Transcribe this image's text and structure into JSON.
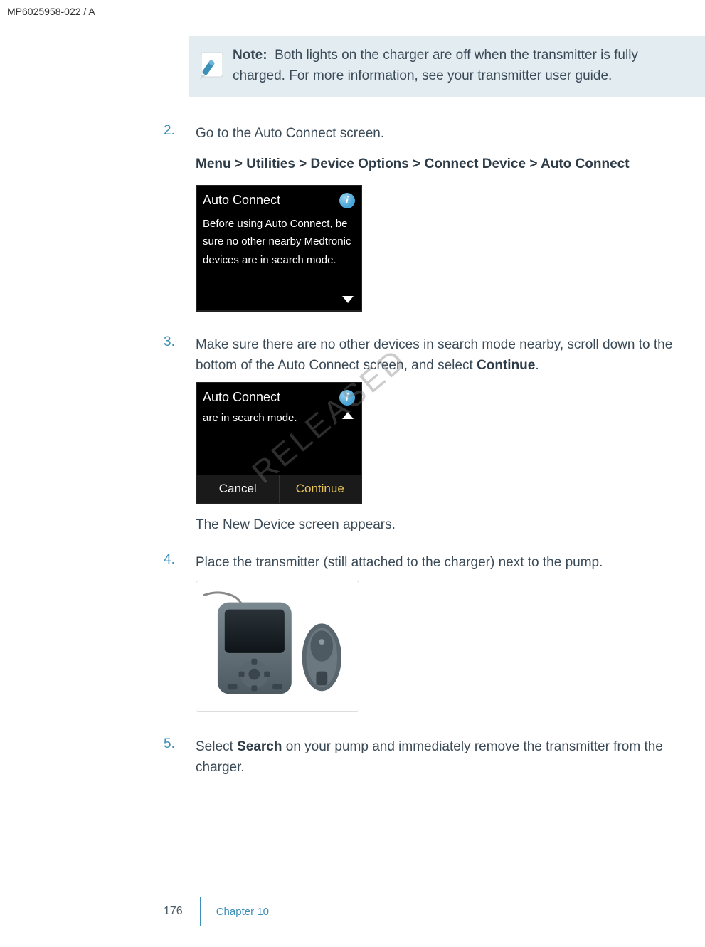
{
  "header_id": "MP6025958-022 / A",
  "note": {
    "label": "Note:",
    "text": "Both lights on the charger are off when the transmitter is fully charged. For more information, see your transmitter user guide."
  },
  "steps": {
    "s2": {
      "num": "2.",
      "text": "Go to the Auto Connect screen.",
      "menu_path": "Menu > Utilities > Device Options > Connect Device > Auto Connect",
      "screen": {
        "title": "Auto Connect",
        "body": "Before using Auto Connect, be sure no other nearby Medtronic devices are in search mode.",
        "info": "i"
      }
    },
    "s3": {
      "num": "3.",
      "text_before": "Make sure there are no other devices in search mode nearby, scroll down to the bottom of the Auto Connect screen, and select ",
      "bold1": "Continue",
      "text_after": ".",
      "screen": {
        "title": "Auto Connect",
        "body": "are in search mode.",
        "btn_cancel": "Cancel",
        "btn_continue": "Continue",
        "info": "i"
      },
      "after_text": "The New Device screen appears."
    },
    "s4": {
      "num": "4.",
      "text": "Place the transmitter (still attached to the charger) next to the pump."
    },
    "s5": {
      "num": "5.",
      "text_before": "Select ",
      "bold1": "Search",
      "text_after": " on your pump and immediately remove the transmitter from the charger."
    }
  },
  "footer": {
    "page": "176",
    "chapter": "Chapter 10"
  },
  "watermark": "RELEASED"
}
